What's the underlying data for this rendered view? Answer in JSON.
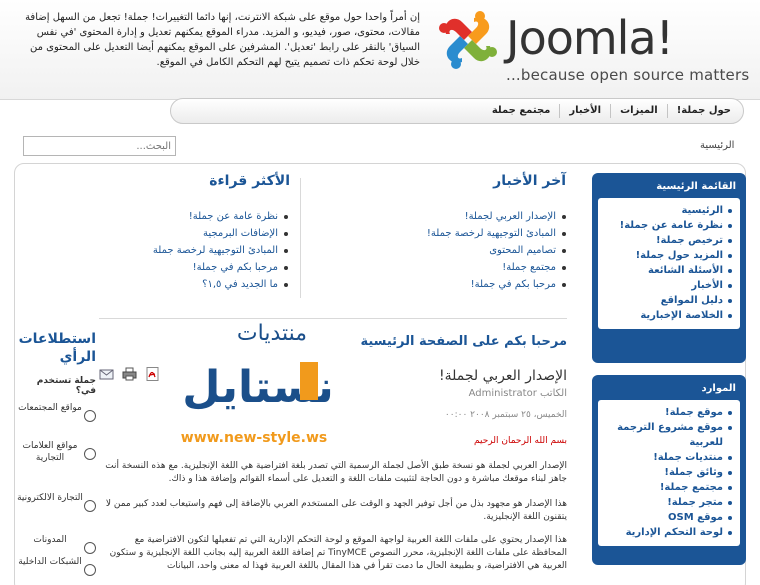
{
  "header": {
    "logo_text": "Joomla!",
    "tagline": "...because open source matters",
    "intro": "إن أمراً واحدا حول موقع على شبكة الانترنت، إنها دائما التغييرات! جملة! تجعل من السهل إضافة مقالات، محتوى، صور، فيديو، و المزيد. مدراء الموقع يمكنهم تعديل و إدارة المحتوى 'في نفس السياق' بالنقر على رابط 'تعديل'. المشرفين على الموقع يمكنهم أيضا التعديل على المحتوى من خلال لوحة تحكم ذات تصميم يتيح لهم التحكم الكامل في الموقع."
  },
  "topnav": {
    "items": [
      "حول جملة!",
      "الميزات",
      "الأخبار",
      "مجتمع جملة"
    ]
  },
  "breadcrumb": "الرئيسية",
  "search": {
    "placeholder": "البحث..."
  },
  "main_menu": {
    "title": "القائمة الرئيسية",
    "items": [
      "الرئيسية",
      "نظرة عامة عن جملة!",
      "ترخيص جملة!",
      "المزيد حول جملة!",
      "الأسئلة الشائعة",
      "الأخبار",
      "دليل المواقع",
      "الخلاصة الإخبارية"
    ]
  },
  "resources": {
    "title": "الموارد",
    "items": [
      "موقع جملة!",
      "موقع مشروع الترجمة للعربية",
      "منتديات جملة!",
      "وثائق جملة!",
      "مجتمع جملة!",
      "متجر جملة!",
      "موقع OSM",
      "لوحة التحكم الإدارية"
    ]
  },
  "latest": {
    "title": "آخر الأخبار",
    "items": [
      "الإصدار العربي لجملة!",
      "المبادئ التوجيهية لرخصة جملة!",
      "تصاميم المحتوى",
      "مجتمع جملة!",
      "مرحبا بكم في جملة!"
    ]
  },
  "popular": {
    "title": "الأكثر قراءة",
    "items": [
      "نظرة عامة عن جملة!",
      "الإضافات البرمجية",
      "المبادئ التوجيهية لرخصة جملة",
      "مرحبا بكم في جملة!",
      "ما الجديد في ١,٥؟"
    ]
  },
  "article": {
    "section_title": "مرحبا بكم على الصفحة الرئيسية",
    "title": "الإصدار العربي لجملة!",
    "author": "الكاتب Administrator",
    "date": "الخميس، ٢٥ سبتمبر ٢٠٠٨ ٠٠:٠٠",
    "basmala": "بسم الله الرحمان الرحيم",
    "para1": "الإصدار العربي لجملة هو نسخة طبق الأصل لجملة الرسمية التي تصدر بلغة افتراضية هي اللغة الإنجليزية. مع هذه النسخة أنت جاهز لبناء موقعك مباشرة و دون الحاجة لتثبيت ملفات اللغة و التعديل على أسماء القوائم وإضافة هذا و ذاك.",
    "para2": "هذا الإصدار هو مجهود بذل من أجل توفير الجهد و الوقت على المستخدم العربي بالإضافة إلى فهم واستيعاب لعدد كبير ممن لا يتقنون اللغة الإنجليزية.",
    "para3": "هذا الإصدار يحتوي على ملفات اللغة العربية لواجهة الموقع و لوحة التحكم الإدارية التي تم تفعيلها لتكون الافتراضية مع المحافظة على ملفات اللغة الإنجليزية، محرر النصوص TinyMCE تم إضافة اللغة العربية إليه بجانب اللغة الإنجليزية و ستكون العربية هي الافتراضية، و بطبيعة الحال ما دمت تقرأ في هذا المقال باللغة العربية فهذا له معنى واحد، البيانات"
  },
  "forum_logo": {
    "top_text": "منتديات",
    "brand": "نستايل",
    "url": "www.new-style.ws"
  },
  "poll": {
    "title": "استطلاعات الرأي",
    "question": "جملة تستخدم في؟",
    "options": [
      "مواقع المجتمعات",
      "مواقع العلامات التجارية",
      "التجارة الالكترونية",
      "المدونات",
      "الشبكات الداخلية"
    ]
  },
  "colors": {
    "brand_blue": "#1b5596",
    "joomla_red": "#e0302b",
    "joomla_orange": "#f89b1c",
    "joomla_green": "#7fb03a",
    "joomla_blue": "#2a8ccf",
    "forum_orange": "#f19a1c"
  },
  "icons": [
    "email-icon",
    "print-icon",
    "pdf-icon"
  ]
}
